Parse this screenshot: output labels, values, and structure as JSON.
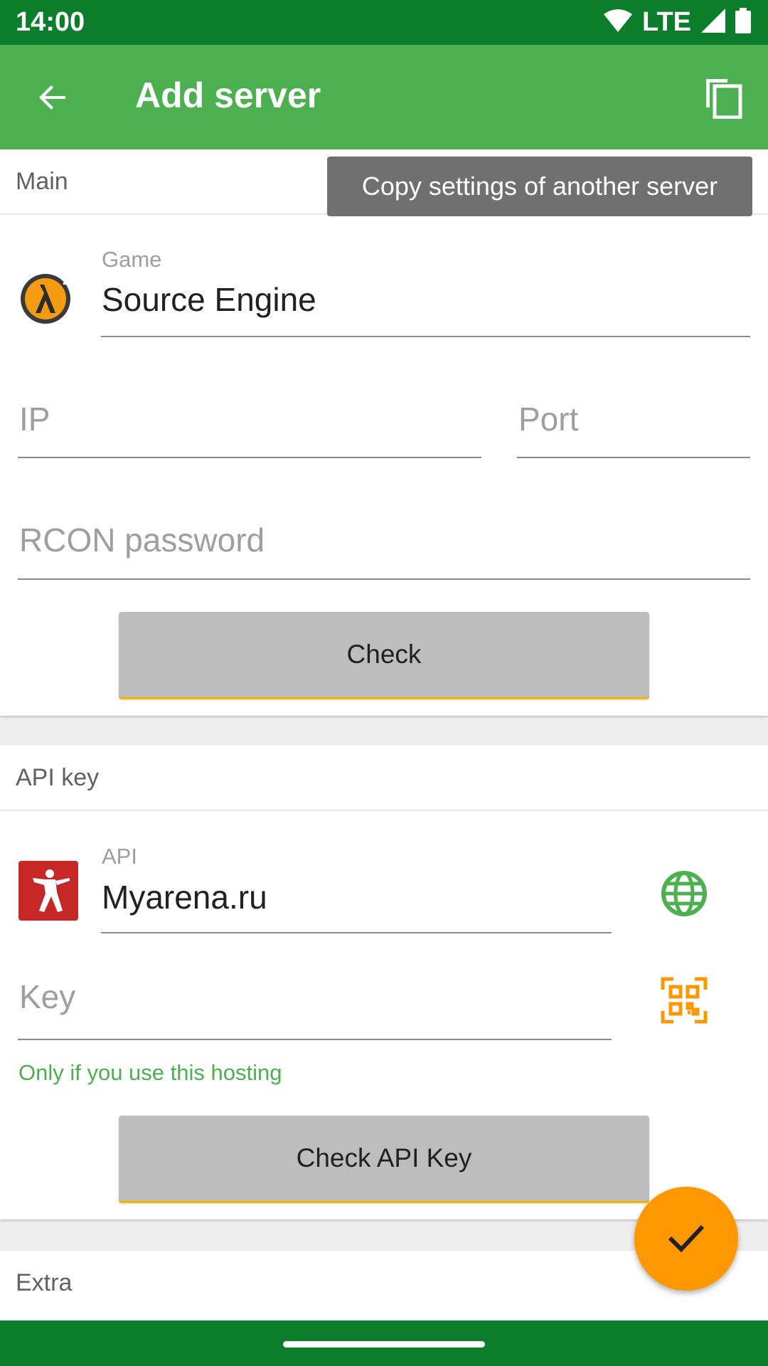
{
  "status_bar": {
    "time": "14:00",
    "network": "LTE"
  },
  "app_bar": {
    "title": "Add server"
  },
  "tooltip": {
    "text": "Copy settings of another server"
  },
  "main_section": {
    "header": "Main",
    "game": {
      "label": "Game",
      "value": "Source Engine",
      "icon": "half-life-2-icon"
    },
    "ip": {
      "placeholder": "IP"
    },
    "port": {
      "placeholder": "Port"
    },
    "rcon": {
      "placeholder": "RCON password"
    },
    "check_button": "Check"
  },
  "api_section": {
    "header": "API key",
    "api": {
      "label": "API",
      "value": "Myarena.ru",
      "icon": "counter-strike-icon"
    },
    "key": {
      "placeholder": "Key"
    },
    "helper": "Only if you use this hosting",
    "check_button": "Check API Key"
  },
  "extra_section": {
    "header": "Extra"
  },
  "colors": {
    "status_bar": "#0b7d2b",
    "app_bar": "#4caf50",
    "fab": "#ff9800",
    "button_underline": "#f4b400",
    "globe": "#4caf50",
    "qr": "#ff9800"
  }
}
